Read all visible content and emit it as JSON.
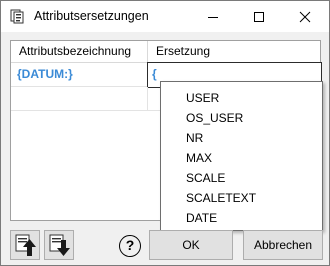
{
  "window": {
    "title": "Attributsersetzungen",
    "icons": {
      "app": "attributes-icon",
      "minimize": "minimize-icon",
      "maximize": "maximize-icon",
      "close": "close-icon"
    }
  },
  "table": {
    "columns": [
      "Attributsbezeichnung",
      "Ersetzung"
    ],
    "rows": [
      {
        "attribute": "{DATUM:}",
        "replacement": "{"
      },
      {
        "attribute": "",
        "replacement": ""
      }
    ]
  },
  "dropdown": {
    "options": [
      "USER",
      "OS_USER",
      "NR",
      "MAX",
      "SCALE",
      "SCALETEXT",
      "DATE"
    ]
  },
  "footer": {
    "move_up_icon": "move-up-icon",
    "move_down_icon": "move-down-icon",
    "help_label": "?",
    "ok_label": "OK",
    "cancel_label": "Abbrechen"
  },
  "colors": {
    "attribute_text": "#3a8ad6",
    "window_bg": "#f0f0f0",
    "button_bg": "#e1e1e1"
  }
}
